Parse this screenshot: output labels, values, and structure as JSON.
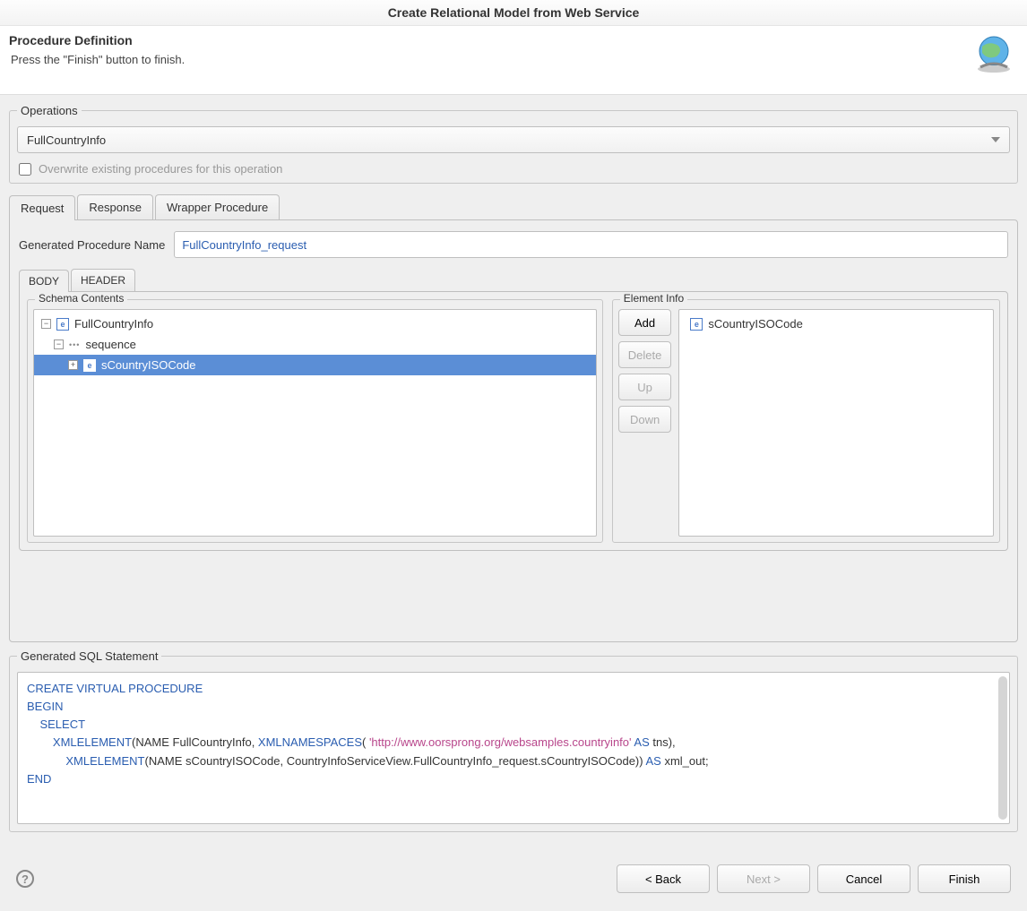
{
  "window": {
    "title": "Create Relational Model from Web Service"
  },
  "header": {
    "title": "Procedure Definition",
    "subtitle": "Press the \"Finish\" button to finish."
  },
  "operations": {
    "legend": "Operations",
    "selected": "FullCountryInfo",
    "overwrite_label": "Overwrite existing procedures for this operation"
  },
  "tabs": {
    "request": "Request",
    "response": "Response",
    "wrapper": "Wrapper Procedure"
  },
  "proc": {
    "name_label": "Generated Procedure Name",
    "name_value": "FullCountryInfo_request"
  },
  "sub_tabs": {
    "body": "BODY",
    "header": "HEADER"
  },
  "schema": {
    "legend": "Schema Contents",
    "items": [
      {
        "label": "FullCountryInfo",
        "type": "e",
        "expand": "−",
        "indent": 0
      },
      {
        "label": "sequence",
        "type": "seq",
        "expand": "−",
        "indent": 1
      },
      {
        "label": "sCountryISOCode",
        "type": "e",
        "expand": "+",
        "indent": 2,
        "selected": true
      }
    ]
  },
  "elem": {
    "legend": "Element Info",
    "buttons": {
      "add": "Add",
      "delete": "Delete",
      "up": "Up",
      "down": "Down"
    },
    "items": [
      {
        "label": "sCountryISOCode"
      }
    ]
  },
  "sql": {
    "legend": "Generated SQL Statement",
    "kw": {
      "create": "CREATE VIRTUAL PROCEDURE",
      "begin": "BEGIN",
      "select": "SELECT",
      "xmlel": "XMLELEMENT",
      "xmlns": "XMLNAMESPACES",
      "as": "AS",
      "end": "END"
    },
    "text": {
      "l3a": "(NAME FullCountryInfo, ",
      "l3b": "( ",
      "url": "'http://www.oorsprong.org/websamples.countryinfo'",
      "l3c": " tns),",
      "l4a": "(NAME sCountryISOCode, CountryInfoServiceView.FullCountryInfo_request.sCountryISOCode)) ",
      "l4b": " xml_out;"
    }
  },
  "footer": {
    "back": "< Back",
    "next": "Next >",
    "cancel": "Cancel",
    "finish": "Finish"
  }
}
